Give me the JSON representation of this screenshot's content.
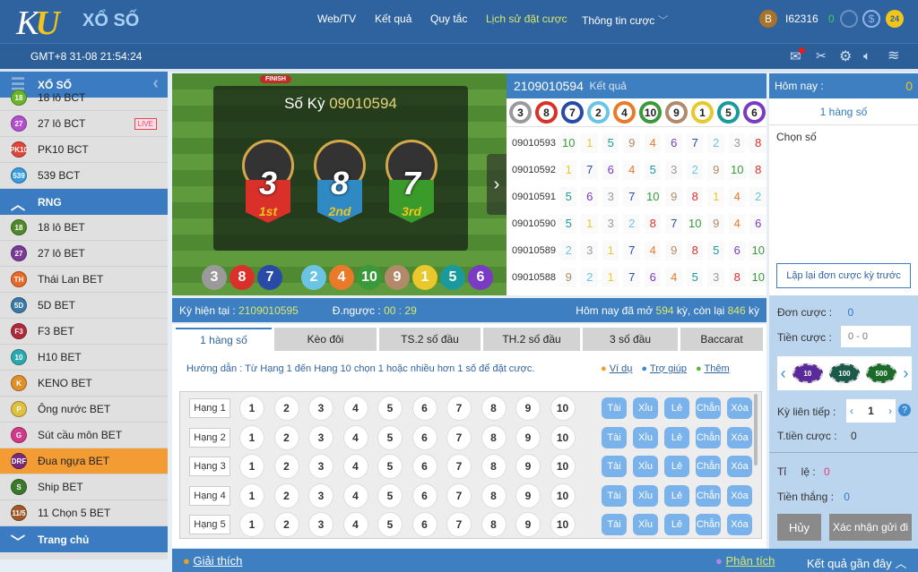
{
  "header": {
    "logo": "KU",
    "brand": "XỔ SỐ",
    "nav": [
      "Web/TV",
      "Kết quả",
      "Quy tắc",
      "Lịch sử đặt cược",
      "Thông tin cược"
    ],
    "user_badge": "B",
    "username": "I62316",
    "balance": "0",
    "support": "24"
  },
  "subheader": {
    "datetime": "GMT+8 31-08 21:54:24",
    "icons": [
      "mail-icon",
      "tools-icon",
      "gear-icon",
      "speaker-icon",
      "wifi-icon"
    ]
  },
  "sidebar": {
    "title": "XỔ SỐ",
    "items_top": [
      {
        "label": "18 lô BCT",
        "icon": "18",
        "color": "#6bb52c"
      },
      {
        "label": "27 lô BCT",
        "icon": "27",
        "color": "#b34fd0",
        "live": "LIVE"
      },
      {
        "label": "PK10 BCT",
        "icon": "PK10",
        "color": "#e0473a"
      },
      {
        "label": "539 BCT",
        "icon": "539",
        "color": "#3a9ce0"
      }
    ],
    "section": "RNG",
    "items": [
      {
        "label": "18 lô BET",
        "icon": "18",
        "color": "#4f8a2a"
      },
      {
        "label": "27 lô BET",
        "icon": "27",
        "color": "#7b3a9a"
      },
      {
        "label": "Thái Lan BET",
        "icon": "TH",
        "color": "#e86a2a"
      },
      {
        "label": "5D BET",
        "icon": "5D",
        "color": "#3a7aa8"
      },
      {
        "label": "F3 BET",
        "icon": "F3",
        "color": "#b02a3a"
      },
      {
        "label": "H10 BET",
        "icon": "10",
        "color": "#2aaab0"
      },
      {
        "label": "KENO BET",
        "icon": "K",
        "color": "#e0902a"
      },
      {
        "label": "Ông nước BET",
        "icon": "P",
        "color": "#e0c040"
      },
      {
        "label": "Sút cầu môn BET",
        "icon": "G",
        "color": "#d03a8a"
      },
      {
        "label": "Đua ngựa BET",
        "icon": "DRF",
        "color": "#7a2a7a",
        "active": true
      },
      {
        "label": "Ship BET",
        "icon": "S",
        "color": "#3a7a2a"
      },
      {
        "label": "11 Chọn 5 BET",
        "icon": "11/5",
        "color": "#a05a2a"
      }
    ],
    "footer": "Trang chủ"
  },
  "game": {
    "period_label": "Số Kỳ",
    "period": "09010594",
    "finish": "FINISH",
    "podium": [
      {
        "num": "3",
        "place": "1st",
        "color": "#d9302a"
      },
      {
        "num": "8",
        "place": "2nd",
        "color": "#2f8ac4"
      },
      {
        "num": "7",
        "place": "3rd",
        "color": "#3a9a2a"
      }
    ],
    "result": [
      "3",
      "8",
      "7",
      "2",
      "4",
      "10",
      "9",
      "1",
      "5",
      "6"
    ]
  },
  "ball_colors": {
    "1": "#e8c82a",
    "2": "#6cc4e4",
    "3": "#9a9a9a",
    "4": "#e87a2a",
    "5": "#1a9a9a",
    "6": "#7a3ac4",
    "7": "#2a4aa8",
    "8": "#d9302a",
    "9": "#b08a6a",
    "10": "#3a9a3a"
  },
  "results": {
    "period": "2109010594",
    "label": "Kết quả",
    "latest": [
      "3",
      "8",
      "7",
      "2",
      "4",
      "10",
      "9",
      "1",
      "5",
      "6"
    ],
    "rows": [
      {
        "period": "09010593",
        "nums": [
          "10",
          "1",
          "5",
          "9",
          "4",
          "6",
          "7",
          "2",
          "3",
          "8"
        ]
      },
      {
        "period": "09010592",
        "nums": [
          "1",
          "7",
          "6",
          "4",
          "5",
          "3",
          "2",
          "9",
          "10",
          "8"
        ]
      },
      {
        "period": "09010591",
        "nums": [
          "5",
          "6",
          "3",
          "7",
          "10",
          "9",
          "8",
          "1",
          "4",
          "2"
        ]
      },
      {
        "period": "09010590",
        "nums": [
          "5",
          "1",
          "3",
          "2",
          "8",
          "7",
          "10",
          "9",
          "4",
          "6"
        ]
      },
      {
        "period": "09010589",
        "nums": [
          "2",
          "3",
          "1",
          "7",
          "4",
          "9",
          "8",
          "5",
          "6",
          "10"
        ]
      },
      {
        "period": "09010588",
        "nums": [
          "9",
          "2",
          "1",
          "7",
          "6",
          "4",
          "5",
          "3",
          "8",
          "10"
        ]
      }
    ]
  },
  "right": {
    "today_label": "Hôm nay :",
    "today_value": "0",
    "mode": "1 hàng số",
    "choose": "Chọn số",
    "repeat": "Lặp lại đơn cược kỳ trước",
    "don_cuoc_label": "Đơn cược :",
    "don_cuoc": "0",
    "tien_cuoc_label": "Tiền cược :",
    "tien_cuoc_placeholder": "0 - 0",
    "chips": [
      "10",
      "100",
      "500"
    ],
    "ky_label": "Kỳ liên tiếp :",
    "ky_value": "1",
    "total_label": "T.tiền cược :",
    "total": "0",
    "rate_label": "Tỉ     lệ :",
    "rate": "0",
    "win_label": "Tiền thắng :",
    "win": "0",
    "cancel": "Hủy",
    "confirm": "Xác nhận gửi đi"
  },
  "info": {
    "current_label": "Kỳ hiện tại  :",
    "current": "2109010595",
    "countdown_label": "Đ.ngược :",
    "countdown": "00 : 29",
    "today_pre": "Hôm nay đã mở",
    "opened": "594",
    "mid": "kỳ, còn lại",
    "remaining": "846",
    "suffix": "kỳ"
  },
  "tabs": [
    "1 hàng số",
    "Kèo đôi",
    "TS.2 số đầu",
    "TH.2 số đầu",
    "3 số đầu",
    "Baccarat"
  ],
  "hint": {
    "text": "Hướng dẫn : Từ Hạng 1 đến Hạng 10 chọn 1 hoặc nhiều hơn 1 số để đặt cược.",
    "example": "Ví dụ",
    "help": "Trợ giúp",
    "more": "Thêm"
  },
  "grid": {
    "rows": [
      "Hạng 1",
      "Hạng 2",
      "Hạng 3",
      "Hạng 4",
      "Hạng 5"
    ],
    "numbers": [
      "1",
      "2",
      "3",
      "4",
      "5",
      "6",
      "7",
      "8",
      "9",
      "10"
    ],
    "quick": [
      "Tài",
      "Xỉu",
      "Lẻ",
      "Chẵn",
      "Xóa"
    ]
  },
  "footer": {
    "explain": "Giải thích",
    "analysis": "Phân tích",
    "recent": "Kết quả gần đây"
  }
}
